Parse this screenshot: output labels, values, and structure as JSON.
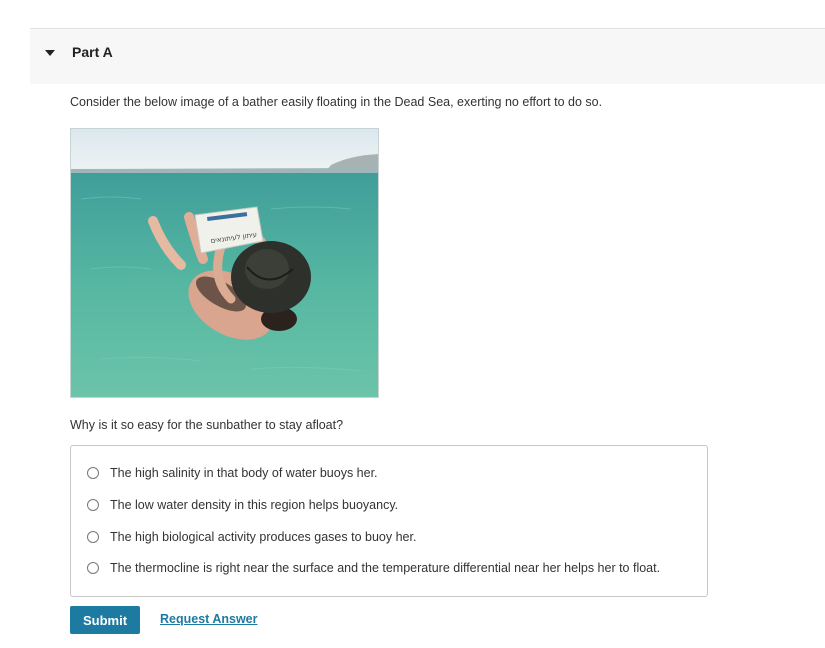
{
  "part": {
    "title": "Part A",
    "caret_icon": "caret-down-icon"
  },
  "intro_text": "Consider the below image of a bather easily floating in the Dead Sea, exerting no effort to do so.",
  "image": {
    "newspaper_text": "עיתון לעיתונאים"
  },
  "question": "Why is it so easy for the sunbather to stay afloat?",
  "options": [
    {
      "label": "The high salinity in that body of water buoys her.",
      "selected": false
    },
    {
      "label": "The low water density in this region helps buoyancy.",
      "selected": false
    },
    {
      "label": "The high biological activity produces gases to buoy her.",
      "selected": false
    },
    {
      "label": "The thermocline is right near the surface and the temperature differential near her helps her to float.",
      "selected": false
    }
  ],
  "actions": {
    "submit_label": "Submit",
    "request_answer_label": "Request Answer"
  },
  "colors": {
    "accent": "#1d7aa1",
    "header_bg": "#f7f7f7",
    "text": "#333333",
    "border": "#c6c6c6"
  }
}
